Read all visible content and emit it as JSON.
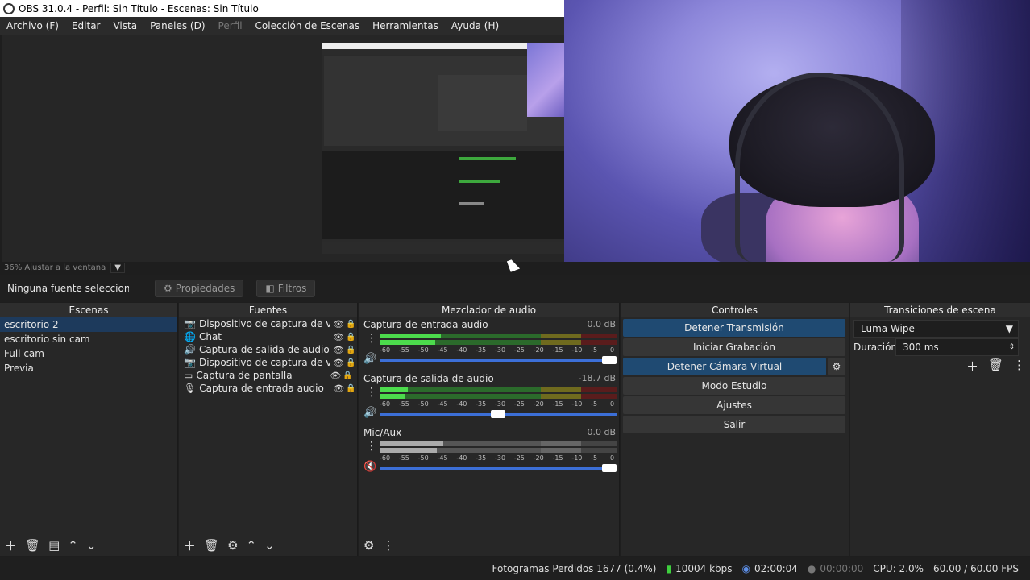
{
  "window": {
    "title": "OBS 31.0.4 - Perfil: Sin Título - Escenas: Sin Título"
  },
  "menu": [
    "Archivo (F)",
    "Editar",
    "Vista",
    "Paneles (D)",
    "Perfil",
    "Colección de Escenas",
    "Herramientas",
    "Ayuda (H)"
  ],
  "preview": {
    "zoom_label": "36% Ajustar a la ventana"
  },
  "context": {
    "no_source": "Ninguna fuente seleccionada",
    "properties": "Propiedades",
    "filters": "Filtros"
  },
  "scenes": {
    "title": "Escenas",
    "items": [
      "escritorio 2",
      "escritorio sin cam",
      "Full cam",
      "Previa"
    ]
  },
  "sources": {
    "title": "Fuentes",
    "items": [
      {
        "label": "Dispositivo de captura de video",
        "icon": "camera-icon"
      },
      {
        "label": "Chat",
        "icon": "globe-icon"
      },
      {
        "label": "Captura de salida de audio",
        "icon": "speaker-icon"
      },
      {
        "label": "Dispositivo de captura de video",
        "icon": "camera-icon"
      },
      {
        "label": "Captura de pantalla",
        "icon": "monitor-icon"
      },
      {
        "label": "Captura de entrada audio",
        "icon": "microphone-icon"
      }
    ]
  },
  "mixer": {
    "title": "Mezclador de audio",
    "ticks": [
      "-60",
      "-55",
      "-50",
      "-45",
      "-40",
      "-35",
      "-30",
      "-25",
      "-20",
      "-15",
      "-10",
      "-5",
      "0"
    ],
    "channels": [
      {
        "name": "Captura de entrada audio",
        "db": "0.0 dB",
        "level": 0.26,
        "volume": 1.0,
        "muted": false
      },
      {
        "name": "Captura de salida de audio",
        "db": "-18.7 dB",
        "level": 0.12,
        "volume": 0.5,
        "muted": false
      },
      {
        "name": "Mic/Aux",
        "db": "0.0 dB",
        "level": 0.27,
        "volume": 1.0,
        "muted": true
      }
    ]
  },
  "controls": {
    "title": "Controles",
    "stop_stream": "Detener Transmisión",
    "start_recording": "Iniciar Grabación",
    "stop_vcam": "Detener Cámara Virtual",
    "studio_mode": "Modo Estudio",
    "settings": "Ajustes",
    "exit": "Salir"
  },
  "transitions": {
    "title": "Transiciones de escena",
    "selected": "Luma Wipe",
    "duration_label": "Duración",
    "duration_value": "300 ms"
  },
  "status": {
    "dropped": "Fotogramas Perdidos 1677 (0.4%)",
    "bitrate": "10004 kbps",
    "stream_time": "02:00:04",
    "rec_time": "00:00:00",
    "cpu": "CPU: 2.0%",
    "fps": "60.00 / 60.00 FPS"
  },
  "colors": {
    "accent": "#1f4a72",
    "meter_green": "#4cdb4c",
    "slider_blue": "#3c6fd7"
  }
}
